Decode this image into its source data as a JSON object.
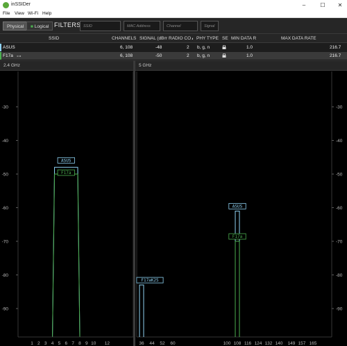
{
  "window": {
    "title": "inSSIDer",
    "minimize": "–",
    "maximize": "☐",
    "close": "✕"
  },
  "menu": [
    "File",
    "View",
    "Wi-Fi",
    "Help"
  ],
  "view_toggle": {
    "physical": "Physical",
    "logical": "Logical",
    "selected": "Physical"
  },
  "filters": {
    "label": "FILTERS:",
    "ssid_placeholder": "SSID",
    "mac_placeholder": "MAC Address",
    "channel_placeholder": "Channel",
    "signal_placeholder": "Signal"
  },
  "table": {
    "columns": [
      "SSID",
      "CHANNELS",
      "SIGNAL (dBm)",
      "RADIO CO▲",
      "PHY TYPE",
      "SE",
      "MIN DATA R",
      "MAX DATA RATE"
    ],
    "rows": [
      {
        "ssid": "ASUS",
        "channels": "6, 108",
        "signal": "-48",
        "radio_count": "2",
        "phy": "b, g, n",
        "min_rate": "1.0",
        "max_rate": "216.7",
        "color": "#8fd3f4",
        "selected": false
      },
      {
        "ssid": "F17a",
        "ssid_extra": "⊶",
        "channels": "6, 108",
        "signal": "-50",
        "radio_count": "2",
        "phy": "b, g, n",
        "min_rate": "1.0",
        "max_rate": "216.7",
        "color": "#4caf50",
        "selected": true
      }
    ]
  },
  "panels": {
    "band24": {
      "title": "2.4 GHz",
      "ylabels": [
        "-30",
        "-40",
        "-50",
        "-60",
        "-70",
        "-80",
        "-90"
      ],
      "xlabels": [
        "1",
        "2",
        "3",
        "4",
        "5",
        "6",
        "7",
        "8",
        "9",
        "10",
        "12"
      ]
    },
    "band5": {
      "title": "5 GHz",
      "ylabels": [
        "-30",
        "-40",
        "-50",
        "-60",
        "-70",
        "-80",
        "-90"
      ],
      "xlabels": [
        "36",
        "44",
        "52",
        "60",
        "100",
        "108",
        "116",
        "124",
        "132",
        "140",
        "149",
        "157",
        "165"
      ]
    }
  },
  "chart_data": [
    {
      "type": "area",
      "title": "2.4 GHz",
      "ylim": [
        -100,
        -20
      ],
      "ylabel": "",
      "xlabel": "",
      "categories": [
        "1",
        "2",
        "3",
        "4",
        "5",
        "6",
        "7",
        "8",
        "9",
        "10",
        "12"
      ],
      "series": [
        {
          "name": "ASUS",
          "channel": 6,
          "signal": -48,
          "span": [
            4,
            8
          ],
          "color": "#8fd3f4"
        },
        {
          "name": "F17a",
          "channel": 6,
          "signal": -50,
          "span": [
            4,
            8
          ],
          "color": "#4caf50"
        }
      ]
    },
    {
      "type": "area",
      "title": "5 GHz",
      "ylim": [
        -100,
        -20
      ],
      "ylabel": "",
      "xlabel": "",
      "categories": [
        "36",
        "44",
        "52",
        "60",
        "100",
        "108",
        "116",
        "124",
        "132",
        "140",
        "149",
        "157",
        "165"
      ],
      "series": [
        {
          "name": "F17aK25",
          "channel": 36,
          "signal": -83,
          "color": "#8fd3f4"
        },
        {
          "name": "ASUS",
          "channel": 108,
          "signal": -61,
          "color": "#8fd3f4"
        },
        {
          "name": "F17a",
          "channel": 108,
          "signal": -70,
          "color": "#4caf50"
        }
      ]
    }
  ]
}
